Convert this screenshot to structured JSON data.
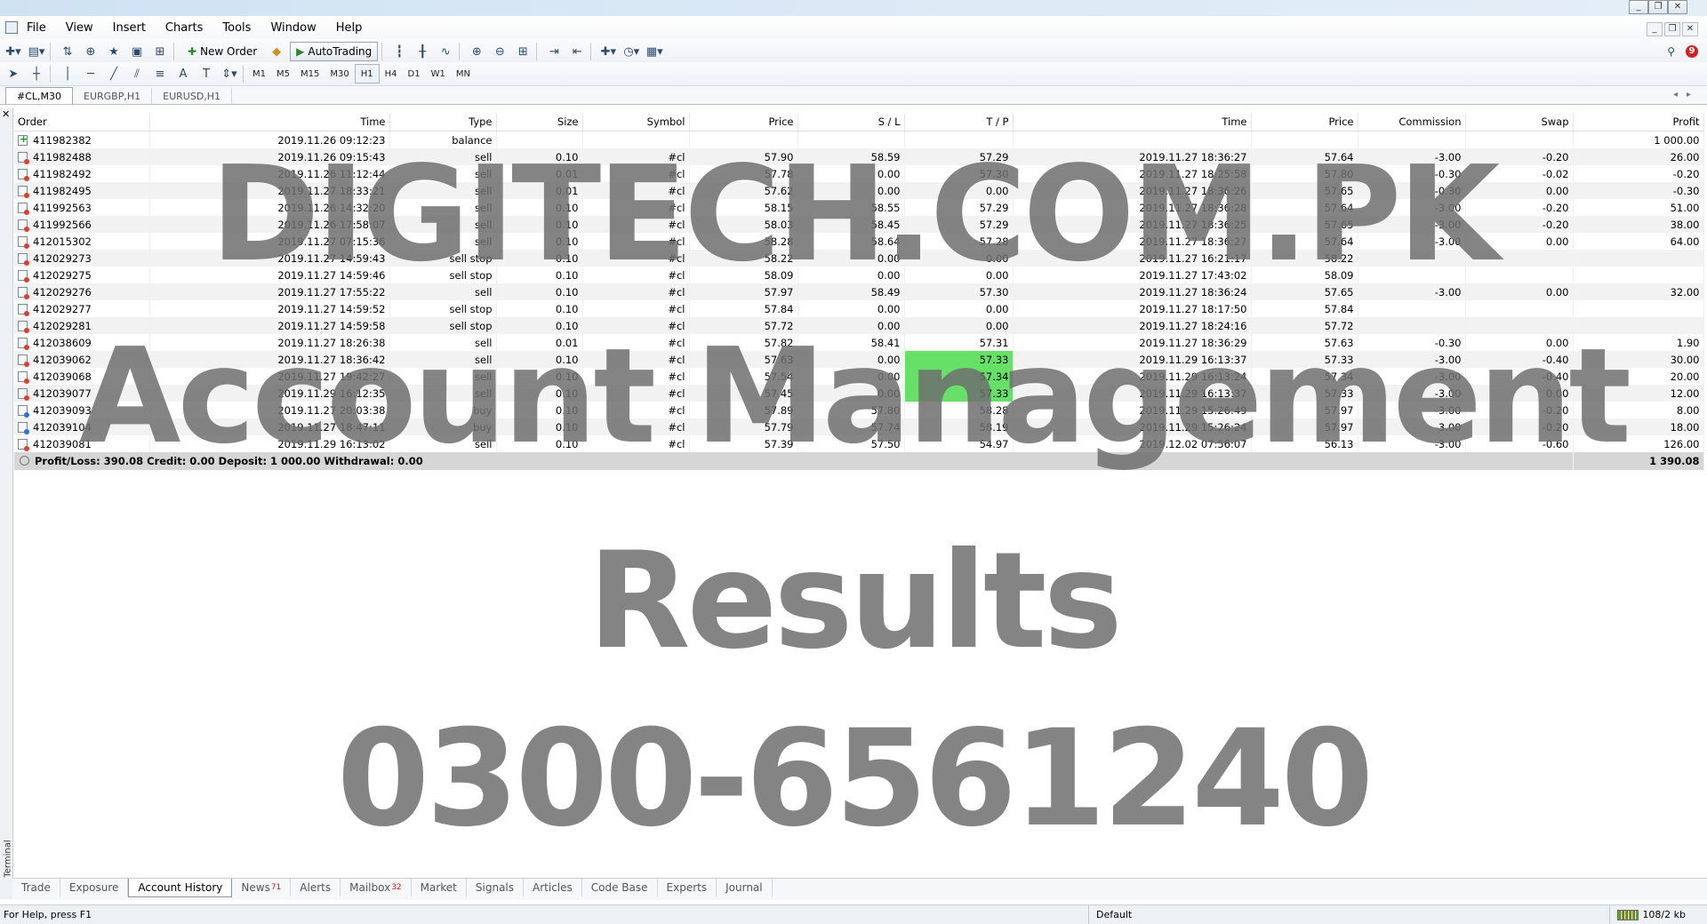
{
  "menu": [
    "File",
    "View",
    "Insert",
    "Charts",
    "Tools",
    "Window",
    "Help"
  ],
  "toolbar": {
    "new_order": "New Order",
    "auto_trading": "AutoTrading",
    "timeframes": [
      "M1",
      "M5",
      "M15",
      "M30",
      "H1",
      "H4",
      "D1",
      "W1",
      "MN"
    ],
    "selected_timeframe": "H1",
    "notification_count": "9"
  },
  "chart_tabs": [
    "#CL,M30",
    "EURGBP,H1",
    "EURUSD,H1"
  ],
  "table": {
    "headers": [
      "Order",
      "Time",
      "Type",
      "Size",
      "Symbol",
      "Price",
      "S / L",
      "T / P",
      "Time",
      "Price",
      "Commission",
      "Swap",
      "Profit"
    ],
    "rows": [
      {
        "kind": "bal",
        "c": [
          "411982382",
          "2019.11.26 09:12:23",
          "balance",
          "",
          "",
          "",
          "",
          "",
          "",
          "",
          "",
          "",
          "1 000.00"
        ]
      },
      {
        "kind": "sell",
        "c": [
          "411982488",
          "2019.11.26 09:15:43",
          "sell",
          "0.10",
          "#cl",
          "57.90",
          "58.59",
          "57.29",
          "2019.11.27 18:36:27",
          "57.64",
          "-3.00",
          "-0.20",
          "26.00"
        ]
      },
      {
        "kind": "sell",
        "c": [
          "411982492",
          "2019.11.26 11:12:44",
          "sell",
          "0.01",
          "#cl",
          "57.78",
          "0.00",
          "57.30",
          "2019.11.27 18:25:58",
          "57.80",
          "-0.30",
          "-0.02",
          "-0.20"
        ]
      },
      {
        "kind": "sell",
        "c": [
          "411982495",
          "2019.11.27 18:33:21",
          "sell",
          "0.01",
          "#cl",
          "57.62",
          "0.00",
          "0.00",
          "2019.11.27 18:36:26",
          "57.65",
          "-0.30",
          "0.00",
          "-0.30"
        ]
      },
      {
        "kind": "sell",
        "c": [
          "411992563",
          "2019.11.26 14:32:20",
          "sell",
          "0.10",
          "#cl",
          "58.15",
          "58.55",
          "57.29",
          "2019.11.27 18:36:28",
          "57.64",
          "-3.00",
          "-0.20",
          "51.00"
        ]
      },
      {
        "kind": "sell",
        "c": [
          "411992566",
          "2019.11.26 17:58:07",
          "sell",
          "0.10",
          "#cl",
          "58.03",
          "58.45",
          "57.29",
          "2019.11.27 18:36:25",
          "57.65",
          "-3.00",
          "-0.20",
          "38.00"
        ]
      },
      {
        "kind": "sell",
        "c": [
          "412015302",
          "2019.11.27 07:15:36",
          "sell",
          "0.10",
          "#cl",
          "58.28",
          "58.64",
          "57.28",
          "2019.11.27 18:36:27",
          "57.64",
          "-3.00",
          "0.00",
          "64.00"
        ]
      },
      {
        "kind": "sell",
        "c": [
          "412029273",
          "2019.11.27 14:59:43",
          "sell stop",
          "0.10",
          "#cl",
          "58.22",
          "0.00",
          "0.00",
          "2019.11.27 16:21:17",
          "58.22",
          "",
          "",
          ""
        ]
      },
      {
        "kind": "sell",
        "c": [
          "412029275",
          "2019.11.27 14:59:46",
          "sell stop",
          "0.10",
          "#cl",
          "58.09",
          "0.00",
          "0.00",
          "2019.11.27 17:43:02",
          "58.09",
          "",
          "",
          ""
        ]
      },
      {
        "kind": "sell",
        "c": [
          "412029276",
          "2019.11.27 17:55:22",
          "sell",
          "0.10",
          "#cl",
          "57.97",
          "58.49",
          "57.30",
          "2019.11.27 18:36:24",
          "57.65",
          "-3.00",
          "0.00",
          "32.00"
        ]
      },
      {
        "kind": "sell",
        "c": [
          "412029277",
          "2019.11.27 14:59:52",
          "sell stop",
          "0.10",
          "#cl",
          "57.84",
          "0.00",
          "0.00",
          "2019.11.27 18:17:50",
          "57.84",
          "",
          "",
          ""
        ]
      },
      {
        "kind": "sell",
        "c": [
          "412029281",
          "2019.11.27 14:59:58",
          "sell stop",
          "0.10",
          "#cl",
          "57.72",
          "0.00",
          "0.00",
          "2019.11.27 18:24:16",
          "57.72",
          "",
          "",
          ""
        ]
      },
      {
        "kind": "sell",
        "c": [
          "412038609",
          "2019.11.27 18:26:38",
          "sell",
          "0.01",
          "#cl",
          "57.82",
          "58.41",
          "57.31",
          "2019.11.27 18:36:29",
          "57.63",
          "-0.30",
          "0.00",
          "1.90"
        ]
      },
      {
        "kind": "sell",
        "hl": true,
        "c": [
          "412039062",
          "2019.11.27 18:36:42",
          "sell",
          "0.10",
          "#cl",
          "57.63",
          "0.00",
          "57.33",
          "2019.11.29 16:13:37",
          "57.33",
          "-3.00",
          "-0.40",
          "30.00"
        ]
      },
      {
        "kind": "sell",
        "hl": true,
        "c": [
          "412039068",
          "2019.11.27 19:42:27",
          "sell",
          "0.10",
          "#cl",
          "57.54",
          "0.00",
          "57.34",
          "2019.11.29 16:13:24",
          "57.34",
          "-3.00",
          "-0.40",
          "20.00"
        ]
      },
      {
        "kind": "sell",
        "hl": true,
        "c": [
          "412039077",
          "2019.11.29 16:12:35",
          "sell",
          "0.10",
          "#cl",
          "57.45",
          "0.00",
          "57.33",
          "2019.11.29 16:13:37",
          "57.33",
          "-3.00",
          "0.00",
          "12.00"
        ]
      },
      {
        "kind": "buy",
        "c": [
          "412039093",
          "2019.11.27 20:03:38",
          "buy",
          "0.10",
          "#cl",
          "57.89",
          "57.80",
          "58.28",
          "2019.11.29 15:26:49",
          "57.97",
          "-3.00",
          "-0.20",
          "8.00"
        ]
      },
      {
        "kind": "buy",
        "c": [
          "412039104",
          "2019.11.27 18:47:11",
          "buy",
          "0.10",
          "#cl",
          "57.79",
          "57.74",
          "58.19",
          "2019.11.29 15:26:24",
          "57.97",
          "-3.00",
          "-0.20",
          "18.00"
        ]
      },
      {
        "kind": "sell",
        "c": [
          "412039081",
          "2019.11.29 16:13:02",
          "sell",
          "0.10",
          "#cl",
          "57.39",
          "57.50",
          "54.97",
          "2019.12.02 07:56:07",
          "56.13",
          "-3.00",
          "-0.60",
          "126.00"
        ]
      }
    ],
    "summary_text": "Profit/Loss: 390.08   Credit: 0.00   Deposit: 1 000.00   Withdrawal: 0.00",
    "summary_total": "1 390.08"
  },
  "watermark": [
    "DIGITECH.COM.PK",
    "Account Management",
    "Results",
    "0300-6561240"
  ],
  "panel_label": "Terminal",
  "bottom_tabs": [
    {
      "label": "Trade"
    },
    {
      "label": "Exposure"
    },
    {
      "label": "Account History",
      "active": true
    },
    {
      "label": "News",
      "count": "71"
    },
    {
      "label": "Alerts"
    },
    {
      "label": "Mailbox",
      "count": "32"
    },
    {
      "label": "Market"
    },
    {
      "label": "Signals"
    },
    {
      "label": "Articles"
    },
    {
      "label": "Code Base"
    },
    {
      "label": "Experts"
    },
    {
      "label": "Journal"
    }
  ],
  "status": {
    "help": "For Help, press F1",
    "profile": "Default",
    "traffic": "108/2 kb"
  }
}
